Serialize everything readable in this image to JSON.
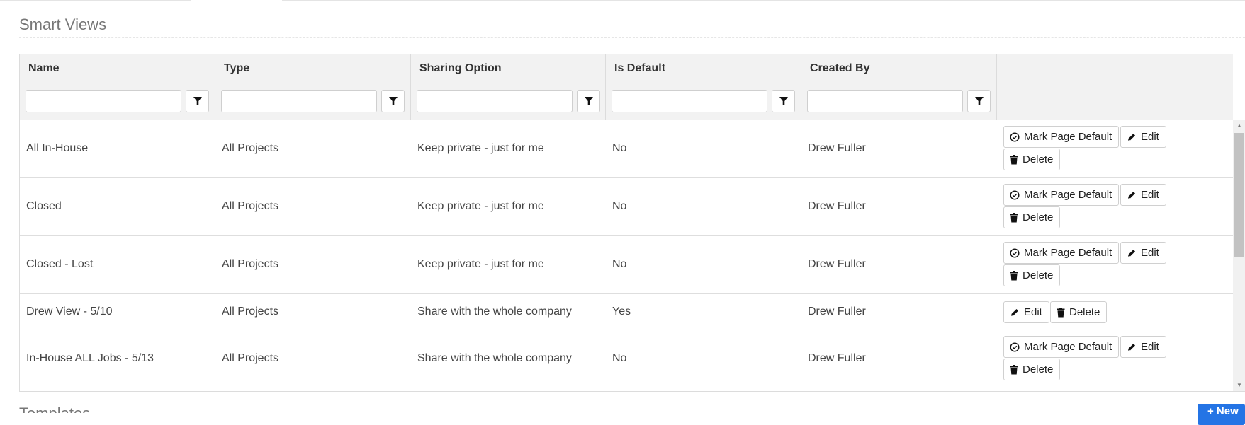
{
  "page": {
    "title": "Smart Views",
    "next_section_title": "Templates",
    "add_button_label": "+ New"
  },
  "table": {
    "columns": [
      "Name",
      "Type",
      "Sharing Option",
      "Is Default",
      "Created By",
      ""
    ],
    "filters": [
      {
        "value": "",
        "icon": "filter-icon"
      },
      {
        "value": "",
        "icon": "filter-icon"
      },
      {
        "value": "",
        "icon": "filter-icon"
      },
      {
        "value": "",
        "icon": "filter-icon"
      },
      {
        "value": "",
        "icon": "filter-icon"
      }
    ],
    "rows": [
      {
        "name": "All In-House",
        "type": "All Projects",
        "sharing": "Keep private - just for me",
        "is_default": "No",
        "created_by": "Drew Fuller",
        "actions": [
          "Mark Page Default",
          "Edit",
          "Delete"
        ]
      },
      {
        "name": "Closed",
        "type": "All Projects",
        "sharing": "Keep private - just for me",
        "is_default": "No",
        "created_by": "Drew Fuller",
        "actions": [
          "Mark Page Default",
          "Edit",
          "Delete"
        ]
      },
      {
        "name": "Closed - Lost",
        "type": "All Projects",
        "sharing": "Keep private - just for me",
        "is_default": "No",
        "created_by": "Drew Fuller",
        "actions": [
          "Mark Page Default",
          "Edit",
          "Delete"
        ]
      },
      {
        "name": "Drew View - 5/10",
        "type": "All Projects",
        "sharing": "Share with the whole company",
        "is_default": "Yes",
        "created_by": "Drew Fuller",
        "actions": [
          "Edit",
          "Delete"
        ]
      },
      {
        "name": "In-House ALL Jobs - 5/13",
        "type": "All Projects",
        "sharing": "Share with the whole company",
        "is_default": "No",
        "created_by": "Drew Fuller",
        "actions": [
          "Mark Page Default",
          "Edit",
          "Delete"
        ]
      }
    ]
  },
  "icons": {
    "mark_default": "check-circle-icon",
    "edit": "pencil-icon",
    "delete": "trash-icon",
    "filter": "filter-icon"
  },
  "colors": {
    "header_bg": "#f2f2f2",
    "primary": "#2474e5"
  }
}
